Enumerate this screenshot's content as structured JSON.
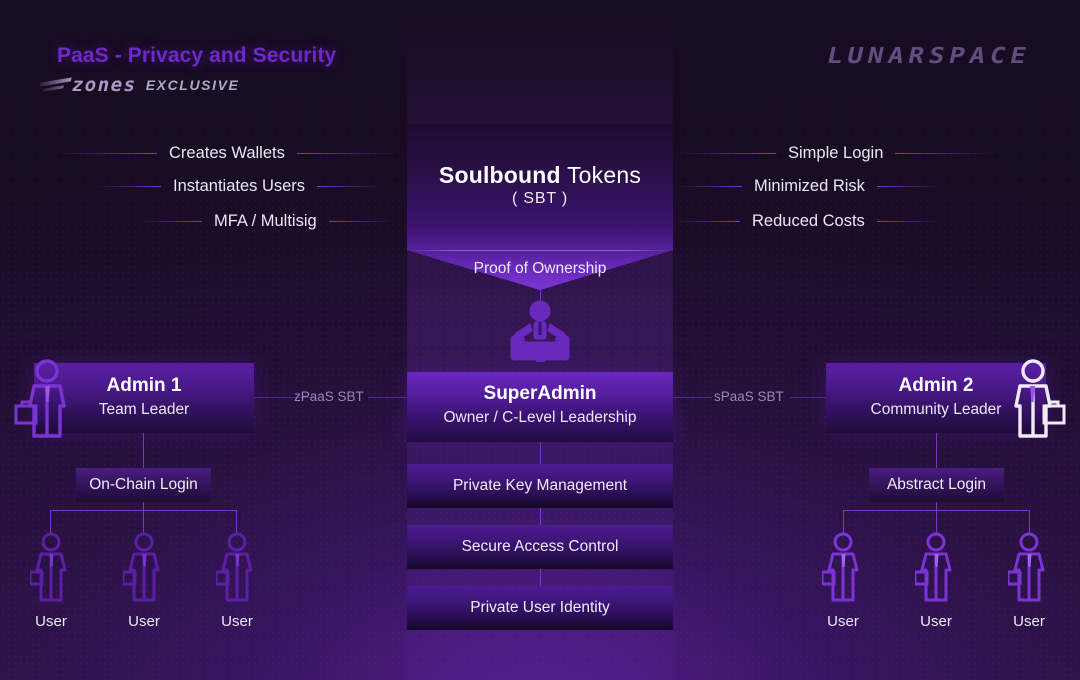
{
  "header": {
    "title": "PaaS - Privacy and Security",
    "logo_word": "zones",
    "logo_tag": "EXCLUSIVE",
    "brand_right": "LUNARSPACE"
  },
  "funnel": {
    "title_bold": "Soulbound",
    "title_rest": " Tokens",
    "subtitle": "( SBT )",
    "proof": "Proof of Ownership"
  },
  "features_left": [
    {
      "label": "Creates Wallets"
    },
    {
      "label": "Instantiates Users"
    },
    {
      "label": "MFA / Multisig"
    }
  ],
  "features_right": [
    {
      "label": "Simple Login"
    },
    {
      "label": "Minimized Risk"
    },
    {
      "label": "Reduced Costs"
    }
  ],
  "roles": {
    "admin1": {
      "title": "Admin 1",
      "subtitle": "Team Leader"
    },
    "superadmin": {
      "title": "SuperAdmin",
      "subtitle": "Owner / C-Level Leadership"
    },
    "admin2": {
      "title": "Admin 2",
      "subtitle": "Community Leader"
    }
  },
  "sbt_links": {
    "left": "zPaaS SBT",
    "right": "sPaaS SBT"
  },
  "center_bars": [
    {
      "label": "Private Key Management"
    },
    {
      "label": "Secure Access Control"
    },
    {
      "label": "Private User Identity"
    }
  ],
  "logins": {
    "left": "On-Chain Login",
    "right": "Abstract Login"
  },
  "users_left": [
    {
      "label": "User"
    },
    {
      "label": "User"
    },
    {
      "label": "User"
    }
  ],
  "users_right": [
    {
      "label": "User"
    },
    {
      "label": "User"
    },
    {
      "label": "User"
    }
  ],
  "colors": {
    "accent": "#6f28c9",
    "line": "#8b3ddd",
    "background": "#2a1044",
    "text": "#ffffff"
  }
}
